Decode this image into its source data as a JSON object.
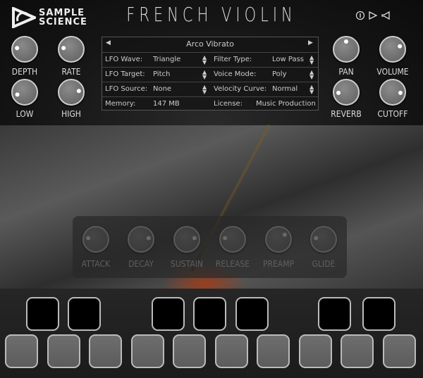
{
  "brand": {
    "logo_line1": "SAMPLE",
    "logo_line2": "SCIENCE",
    "title": "FRENCH VIOLIN"
  },
  "top_icons": [
    "info-icon",
    "play-icon",
    "speaker-icon"
  ],
  "left_knobs": [
    {
      "label": "DEPTH",
      "value": 0.2
    },
    {
      "label": "RATE",
      "value": 0.2
    },
    {
      "label": "LOW",
      "value": 0.1
    },
    {
      "label": "HIGH",
      "value": 0.8
    }
  ],
  "right_knobs": [
    {
      "label": "PAN",
      "value": 0.5
    },
    {
      "label": "VOLUME",
      "value": 0.75
    },
    {
      "label": "REVERB",
      "value": 0.15
    },
    {
      "label": "CUTOFF",
      "value": 0.85
    }
  ],
  "preset": {
    "name": "Arco Vibrato"
  },
  "settings": {
    "lfo_wave": {
      "label": "LFO Wave:",
      "value": "Triangle"
    },
    "lfo_target": {
      "label": "LFO Target:",
      "value": "Pitch"
    },
    "lfo_source": {
      "label": "LFO Source:",
      "value": "None"
    },
    "filter_type": {
      "label": "Filter Type:",
      "value": "Low Pass"
    },
    "voice_mode": {
      "label": "Voice Mode:",
      "value": "Poly"
    },
    "velocity_curve": {
      "label": "Velocity Curve:",
      "value": "Normal"
    },
    "memory": {
      "label": "Memory:",
      "value": "147 MB"
    },
    "license": {
      "label": "License:",
      "value": "Music Production"
    }
  },
  "envelope_knobs": [
    {
      "label": "ATTACK",
      "value": 0.2
    },
    {
      "label": "DECAY",
      "value": 0.8
    },
    {
      "label": "SUSTAIN",
      "value": 0.8
    },
    {
      "label": "RELEASE",
      "value": 0.2
    },
    {
      "label": "PREAMP",
      "value": 0.7
    },
    {
      "label": "GLIDE",
      "value": 0.2
    }
  ],
  "pads": {
    "black_count": 7,
    "white_count": 10
  }
}
